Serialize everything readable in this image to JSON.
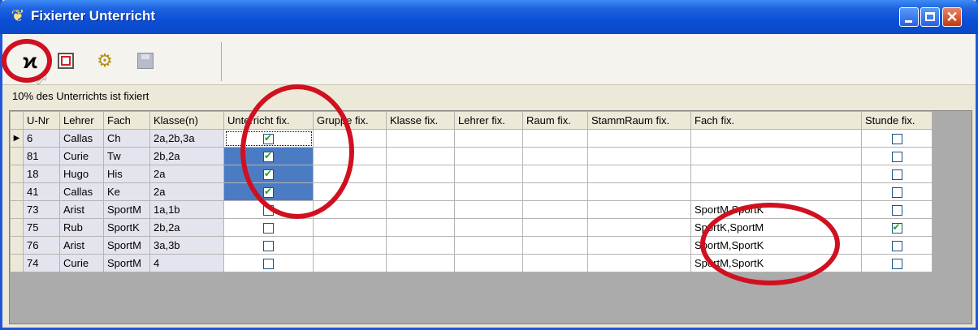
{
  "window": {
    "title": "Fixierter Unterricht"
  },
  "toolbar": {
    "tools": [
      {
        "icon": "fix-toggle-icon",
        "glyph": "X"
      },
      {
        "icon": "grid-view-icon",
        "glyph": ""
      },
      {
        "icon": "gears-icon",
        "glyph": "⚙"
      },
      {
        "icon": "save-icon",
        "glyph": ""
      }
    ]
  },
  "info_text": "10% des Unterrichts ist fixiert",
  "columns": [
    "U-Nr",
    "Lehrer",
    "Fach",
    "Klasse(n)",
    "Unterricht fix.",
    "Gruppe fix.",
    "Klasse fix.",
    "Lehrer fix.",
    "Raum fix.",
    "StammRaum fix.",
    "Fach fix.",
    "Stunde fix."
  ],
  "rows": [
    {
      "current": true,
      "unr": "6",
      "lehrer": "Callas",
      "fach": "Ch",
      "klassen": "2a,2b,3a",
      "unterricht_fix": true,
      "fach_fix": "",
      "stunde_fix": false
    },
    {
      "current": false,
      "unr": "81",
      "lehrer": "Curie",
      "fach": "Tw",
      "klassen": "2b,2a",
      "unterricht_fix": true,
      "fach_fix": "",
      "stunde_fix": false
    },
    {
      "current": false,
      "unr": "18",
      "lehrer": "Hugo",
      "fach": "His",
      "klassen": "2a",
      "unterricht_fix": true,
      "fach_fix": "",
      "stunde_fix": false
    },
    {
      "current": false,
      "unr": "41",
      "lehrer": "Callas",
      "fach": "Ke",
      "klassen": "2a",
      "unterricht_fix": true,
      "fach_fix": "",
      "stunde_fix": false
    },
    {
      "current": false,
      "unr": "73",
      "lehrer": "Arist",
      "fach": "SportM",
      "klassen": "1a,1b",
      "unterricht_fix": false,
      "fach_fix": "SportM,SportK",
      "stunde_fix": false
    },
    {
      "current": false,
      "unr": "75",
      "lehrer": "Rub",
      "fach": "SportK",
      "klassen": "2b,2a",
      "unterricht_fix": false,
      "fach_fix": "SportK,SportM",
      "stunde_fix": true
    },
    {
      "current": false,
      "unr": "76",
      "lehrer": "Arist",
      "fach": "SportM",
      "klassen": "3a,3b",
      "unterricht_fix": false,
      "fach_fix": "SportM,SportK",
      "stunde_fix": false
    },
    {
      "current": false,
      "unr": "74",
      "lehrer": "Curie",
      "fach": "SportM",
      "klassen": "4",
      "unterricht_fix": false,
      "fach_fix": "SportM,SportK",
      "stunde_fix": false
    }
  ],
  "colors": {
    "title_bar": "#0b4fd6",
    "selection": "#4b7cc3",
    "annotation_ring": "#d01020",
    "check": "#21a121"
  }
}
